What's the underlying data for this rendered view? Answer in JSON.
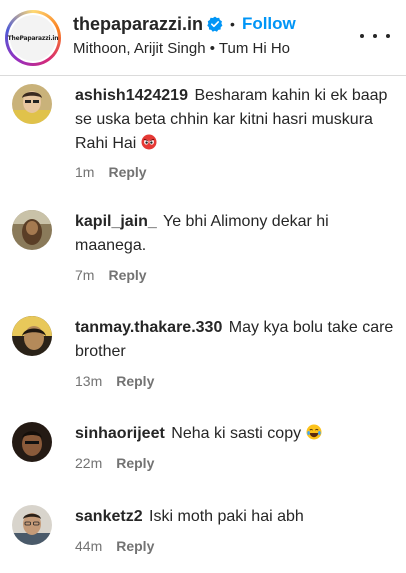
{
  "header": {
    "avatar_text": "ThePaparazzi.in",
    "username": "thepaparazzi.in",
    "separator": "•",
    "follow_label": "Follow",
    "subtitle": "Mithoon, Arijit Singh • Tum Hi Ho",
    "accent_color": "#0095f6"
  },
  "comments": [
    {
      "user": "ashish1424219",
      "text": "Besharam kahin ki ek baap se uska beta chhin kar kitni hasri muskura Rahi Hai",
      "emoji": "angry-eyes-emoji",
      "time": "1m",
      "reply": "Reply"
    },
    {
      "user": "kapil_jain_",
      "text": "Ye bhi Alimony dekar hi maanega.",
      "time": "7m",
      "reply": "Reply"
    },
    {
      "user": "tanmay.thakare.330",
      "text": "May kya bolu take care brother",
      "time": "13m",
      "reply": "Reply"
    },
    {
      "user": "sinhaorijeet",
      "text": "Neha ki sasti copy",
      "emoji": "laughing-tears-emoji",
      "time": "22m",
      "reply": "Reply"
    },
    {
      "user": "sanketz2",
      "text": "Iski moth paki hai abh",
      "time": "44m",
      "reply": "Reply"
    }
  ]
}
